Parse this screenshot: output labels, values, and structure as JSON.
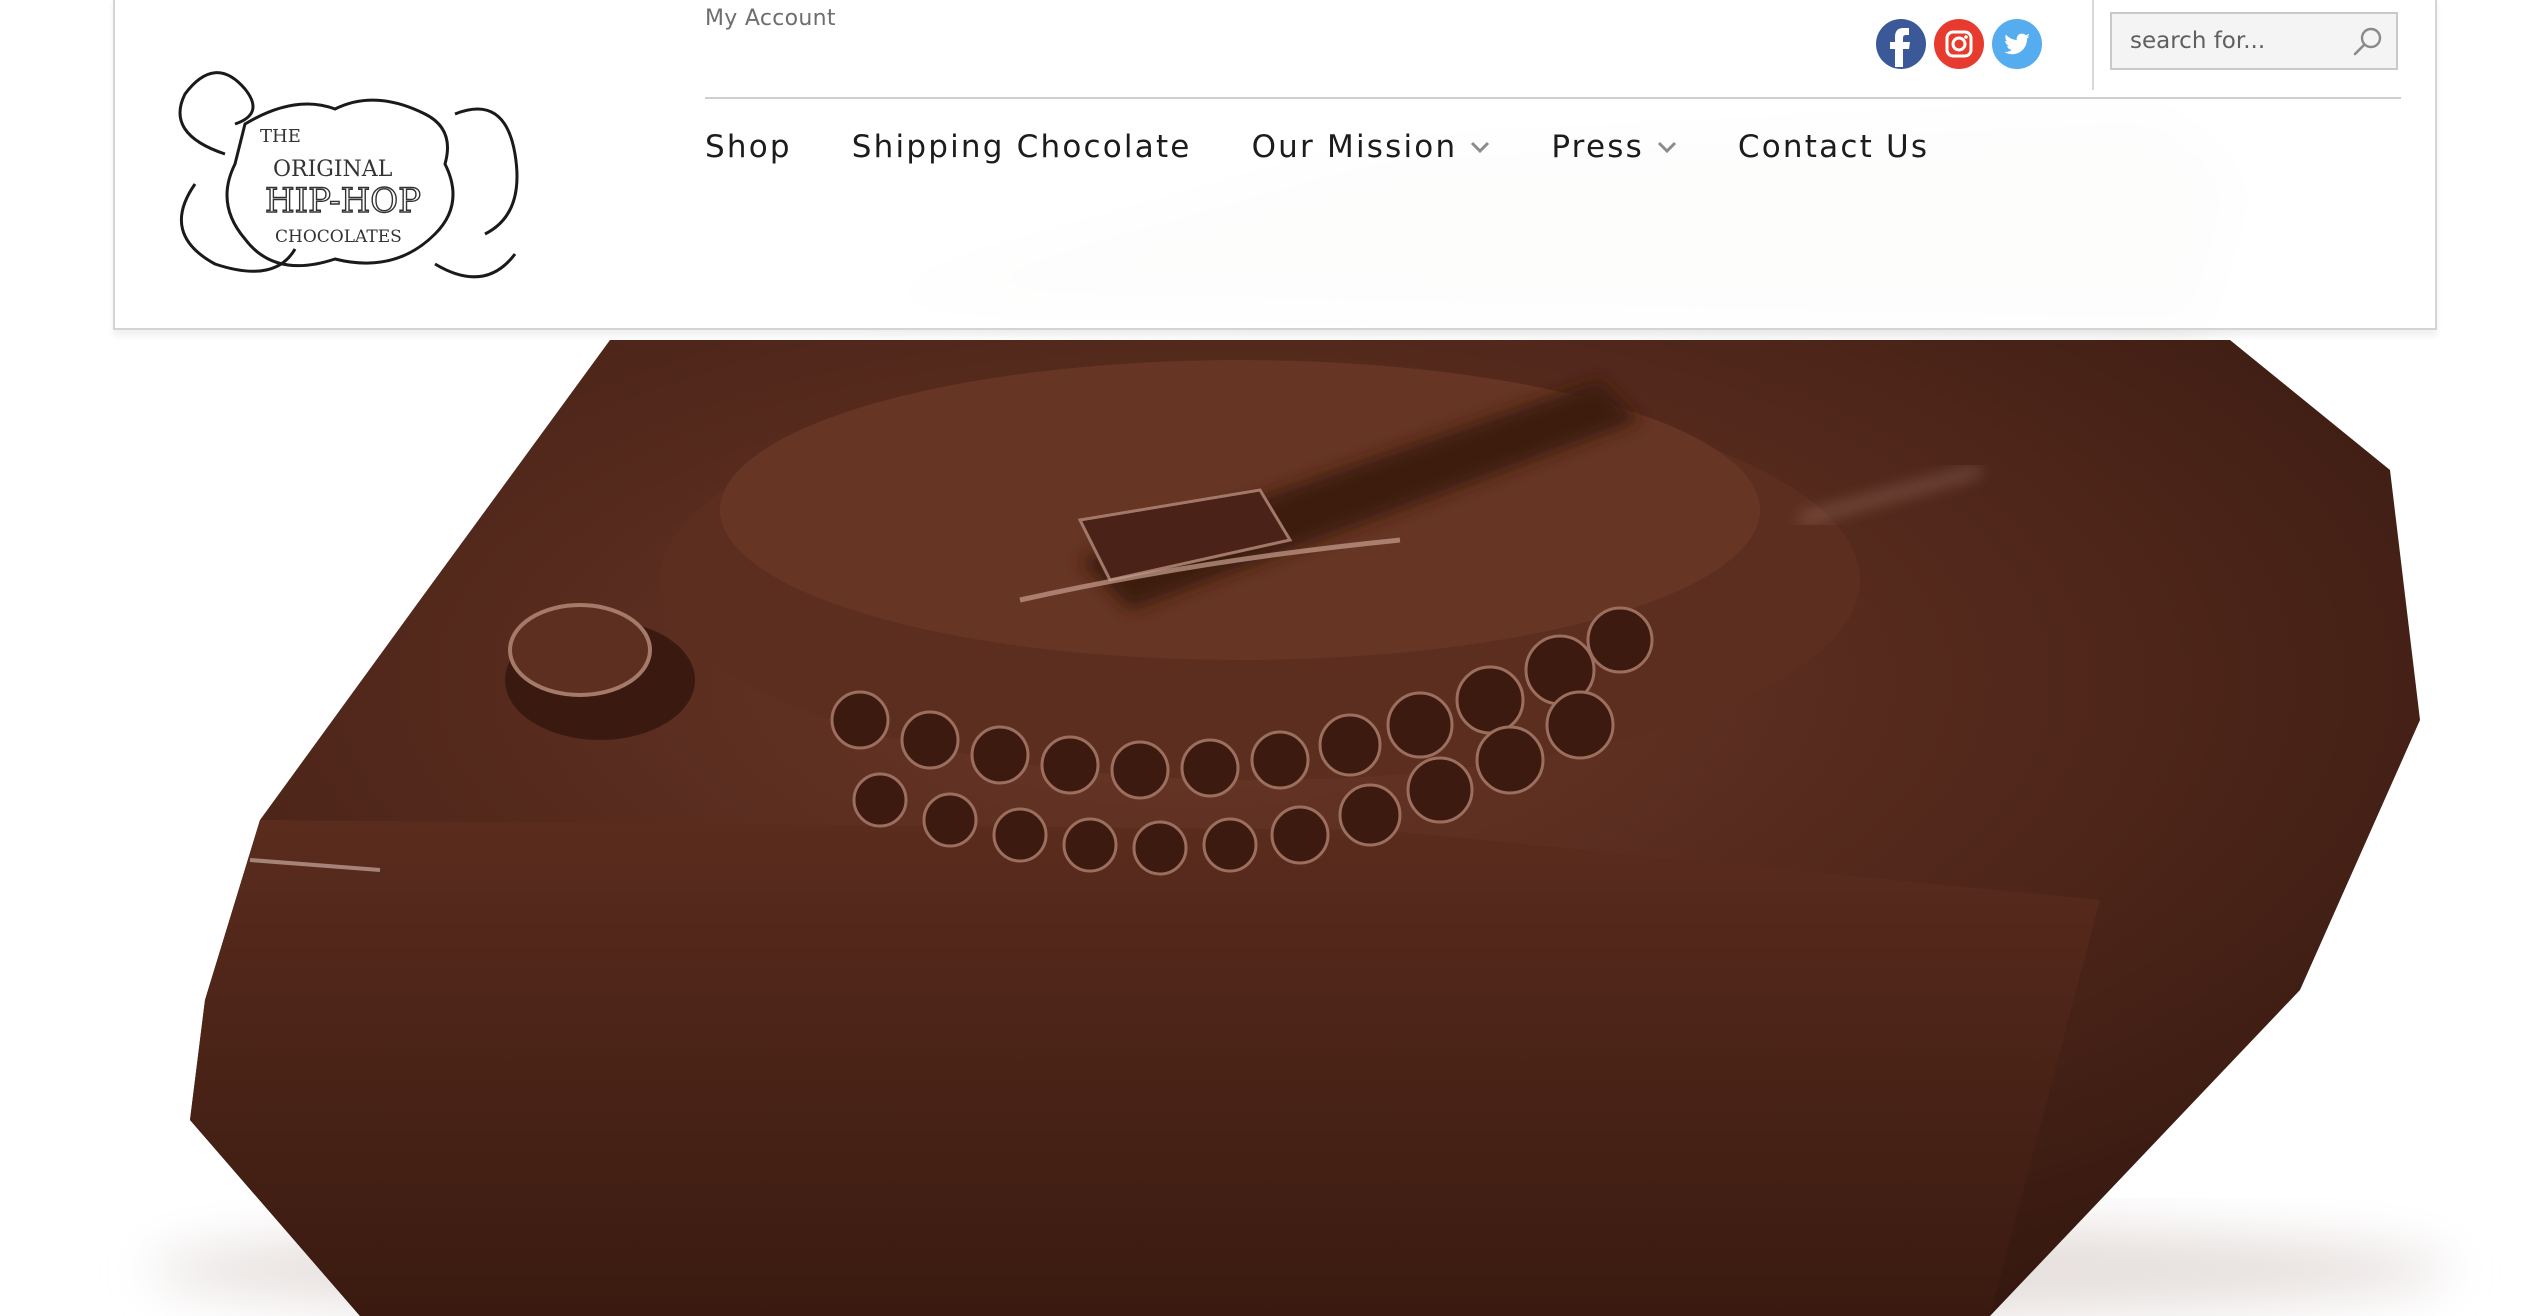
{
  "header": {
    "logo": {
      "lines": [
        "THE",
        "ORIGINAL",
        "HIP-HOP",
        "CHOCOLATES"
      ],
      "icon": "ornate-frame-logo"
    },
    "my_account_label": "My Account",
    "social": [
      {
        "name": "facebook",
        "icon": "facebook-icon",
        "color": "#3b5998"
      },
      {
        "name": "instagram",
        "icon": "instagram-icon",
        "color": "#e63b2e"
      },
      {
        "name": "twitter",
        "icon": "twitter-icon",
        "color": "#55acee"
      }
    ],
    "search": {
      "placeholder": "search for...",
      "value": "",
      "icon": "search-icon"
    },
    "nav": [
      {
        "label": "Shop",
        "has_dropdown": false
      },
      {
        "label": "Shipping Chocolate",
        "has_dropdown": false
      },
      {
        "label": "Our Mission",
        "has_dropdown": true
      },
      {
        "label": "Press",
        "has_dropdown": true
      },
      {
        "label": "Contact Us",
        "has_dropdown": false
      }
    ]
  },
  "hero": {
    "subject": "turntable-shaped-chocolate-image",
    "colors": {
      "chocolate": "#4a2418",
      "highlight": "#8a5a48",
      "background": "#ffffff"
    }
  },
  "colors": {
    "nav_text": "#1c1c1c",
    "muted_text": "#6e6e6e",
    "border": "#d4d4d4"
  }
}
